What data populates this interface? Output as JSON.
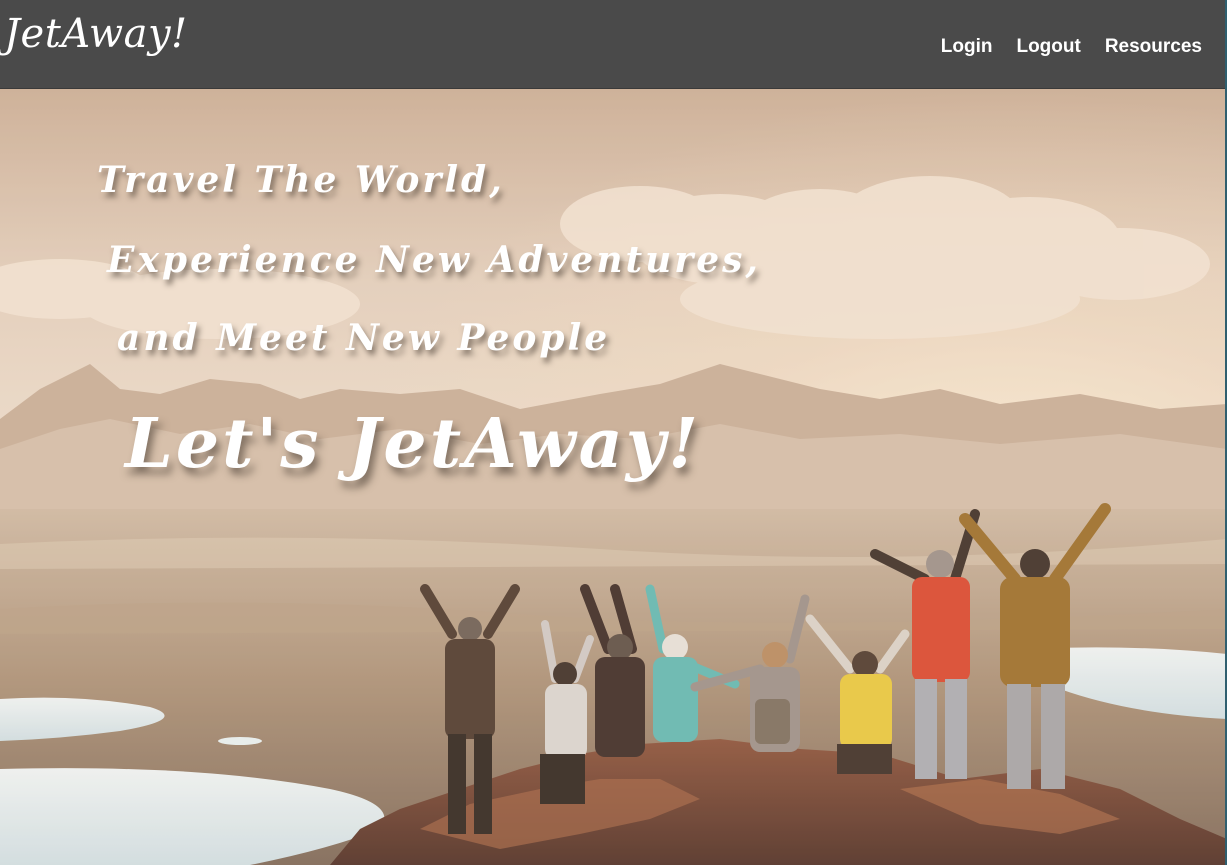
{
  "navbar": {
    "brand": "JetAway!",
    "links": [
      "Login",
      "Logout",
      "Resources"
    ],
    "background": "#4a4a4a"
  },
  "hero": {
    "lines": [
      "Travel The World,",
      "Experience New Adventures,",
      "and Meet New People"
    ],
    "cta": "Let's JetAway!",
    "image": "group-of-travelers-celebrating-on-mountain-summit"
  }
}
